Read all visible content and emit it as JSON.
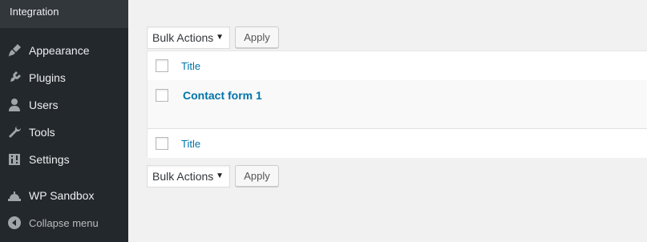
{
  "sidebar": {
    "submenu_tail_label": "Integration",
    "items": [
      {
        "label": "Appearance",
        "icon": "paintbrush-icon"
      },
      {
        "label": "Plugins",
        "icon": "plugin-icon"
      },
      {
        "label": "Users",
        "icon": "user-icon"
      },
      {
        "label": "Tools",
        "icon": "wrench-icon"
      },
      {
        "label": "Settings",
        "icon": "settings-sliders-icon"
      },
      {
        "label": "WP Sandbox",
        "icon": "sandbox-icon"
      }
    ],
    "collapse_label": "Collapse menu"
  },
  "toolbar_top": {
    "bulk_actions": "Bulk Actions",
    "apply": "Apply"
  },
  "toolbar_bottom": {
    "bulk_actions": "Bulk Actions",
    "apply": "Apply"
  },
  "table": {
    "header_title": "Title",
    "rows": [
      {
        "title": "Contact form 1"
      }
    ],
    "footer_title": "Title"
  },
  "colors": {
    "sidebar_bg": "#23282d",
    "submenu_bg": "#32373c",
    "link": "#0073aa",
    "page_bg": "#f1f1f1"
  }
}
